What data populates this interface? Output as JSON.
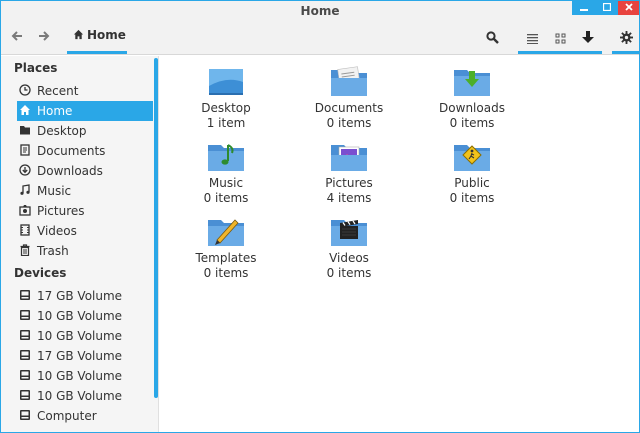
{
  "window": {
    "title": "Home",
    "minimize_icon": "minimize-icon",
    "maximize_icon": "maximize-icon",
    "close_icon": "close-icon"
  },
  "toolbar": {
    "back_icon": "arrow-left-icon",
    "forward_icon": "arrow-right-icon",
    "breadcrumb_label": "Home",
    "breadcrumb_icon": "home-icon",
    "search_icon": "search-icon",
    "list_view_icon": "list-view-icon",
    "grid_view_icon": "grid-view-icon",
    "download_icon": "download-icon",
    "settings_icon": "gear-icon"
  },
  "sidebar": {
    "places_heading": "Places",
    "places": [
      {
        "label": "Recent",
        "icon": "clock-icon"
      },
      {
        "label": "Home",
        "icon": "home-icon",
        "active": true
      },
      {
        "label": "Desktop",
        "icon": "folder-icon"
      },
      {
        "label": "Documents",
        "icon": "document-icon"
      },
      {
        "label": "Downloads",
        "icon": "download-circle-icon"
      },
      {
        "label": "Music",
        "icon": "music-icon"
      },
      {
        "label": "Pictures",
        "icon": "picture-icon"
      },
      {
        "label": "Videos",
        "icon": "film-icon"
      },
      {
        "label": "Trash",
        "icon": "trash-icon"
      }
    ],
    "devices_heading": "Devices",
    "devices": [
      {
        "label": "17 GB Volume",
        "icon": "drive-icon"
      },
      {
        "label": "10 GB Volume",
        "icon": "drive-icon"
      },
      {
        "label": "10 GB Volume",
        "icon": "drive-icon"
      },
      {
        "label": "17 GB Volume",
        "icon": "drive-icon"
      },
      {
        "label": "10 GB Volume",
        "icon": "drive-icon"
      },
      {
        "label": "10 GB Volume",
        "icon": "drive-icon"
      },
      {
        "label": "Computer",
        "icon": "drive-icon"
      }
    ]
  },
  "main": {
    "folders": [
      {
        "name": "Desktop",
        "count": "1 item",
        "emblem": "desktop-folder-icon"
      },
      {
        "name": "Documents",
        "count": "0 items",
        "emblem": "documents-folder-icon"
      },
      {
        "name": "Downloads",
        "count": "0 items",
        "emblem": "downloads-folder-icon"
      },
      {
        "name": "Music",
        "count": "0 items",
        "emblem": "music-folder-icon"
      },
      {
        "name": "Pictures",
        "count": "4 items",
        "emblem": "pictures-folder-icon"
      },
      {
        "name": "Public",
        "count": "0 items",
        "emblem": "public-folder-icon"
      },
      {
        "name": "Templates",
        "count": "0 items",
        "emblem": "templates-folder-icon"
      },
      {
        "name": "Videos",
        "count": "0 items",
        "emblem": "videos-folder-icon"
      }
    ]
  },
  "colors": {
    "accent": "#2aa7e7",
    "close": "#e8433f",
    "folder": "#5d9ede"
  }
}
